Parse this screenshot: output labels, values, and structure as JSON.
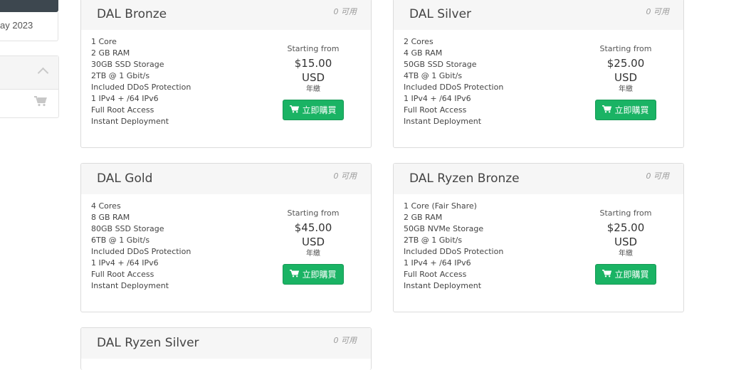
{
  "sidebar": {
    "date_fragment": "ay 2023"
  },
  "products": [
    {
      "name": "DAL Bronze",
      "availability": "0 可用",
      "features": [
        "1 Core",
        "2 GB RAM",
        "30GB SSD Storage",
        "2TB @ 1 Gbit/s",
        "Included DDoS Protection",
        "1 IPv4 + /64 IPv6",
        "Full Root Access",
        "Instant Deployment"
      ],
      "starting_from": "Starting from",
      "price": "$15.00 USD",
      "cycle": "年繳",
      "buy_label": "立即購買"
    },
    {
      "name": "DAL Silver",
      "availability": "0 可用",
      "features": [
        "2 Cores",
        "4 GB RAM",
        "50GB SSD Storage",
        "4TB @ 1 Gbit/s",
        "Included DDoS Protection",
        "1 IPv4 + /64 IPv6",
        "Full Root Access",
        "Instant Deployment"
      ],
      "starting_from": "Starting from",
      "price": "$25.00 USD",
      "cycle": "年繳",
      "buy_label": "立即購買"
    },
    {
      "name": "DAL Gold",
      "availability": "0 可用",
      "features": [
        "4 Cores",
        "8 GB RAM",
        "80GB SSD Storage",
        "6TB @ 1 Gbit/s",
        "Included DDoS Protection",
        "1 IPv4 + /64 IPv6",
        "Full Root Access",
        "Instant Deployment"
      ],
      "starting_from": "Starting from",
      "price": "$45.00 USD",
      "cycle": "年繳",
      "buy_label": "立即購買"
    },
    {
      "name": "DAL Ryzen Bronze",
      "availability": "0 可用",
      "features": [
        "1 Core (Fair Share)",
        "2 GB RAM",
        "50GB NVMe Storage",
        "2TB @ 1 Gbit/s",
        "Included DDoS Protection",
        "1 IPv4 + /64 IPv6",
        "Full Root Access",
        "Instant Deployment"
      ],
      "starting_from": "Starting from",
      "price": "$25.00 USD",
      "cycle": "年繳",
      "buy_label": "立即購買"
    },
    {
      "name": "DAL Ryzen Silver",
      "availability": "0 可用"
    }
  ],
  "colors": {
    "buy_button": "#1ab364",
    "card_header": "#f6f6f6",
    "sidebar_dark": "#3d474f"
  },
  "icons": {
    "buy": "cart-icon",
    "sidebar_collapse": "chevron-up-icon",
    "sidebar_cart": "cart-icon"
  }
}
